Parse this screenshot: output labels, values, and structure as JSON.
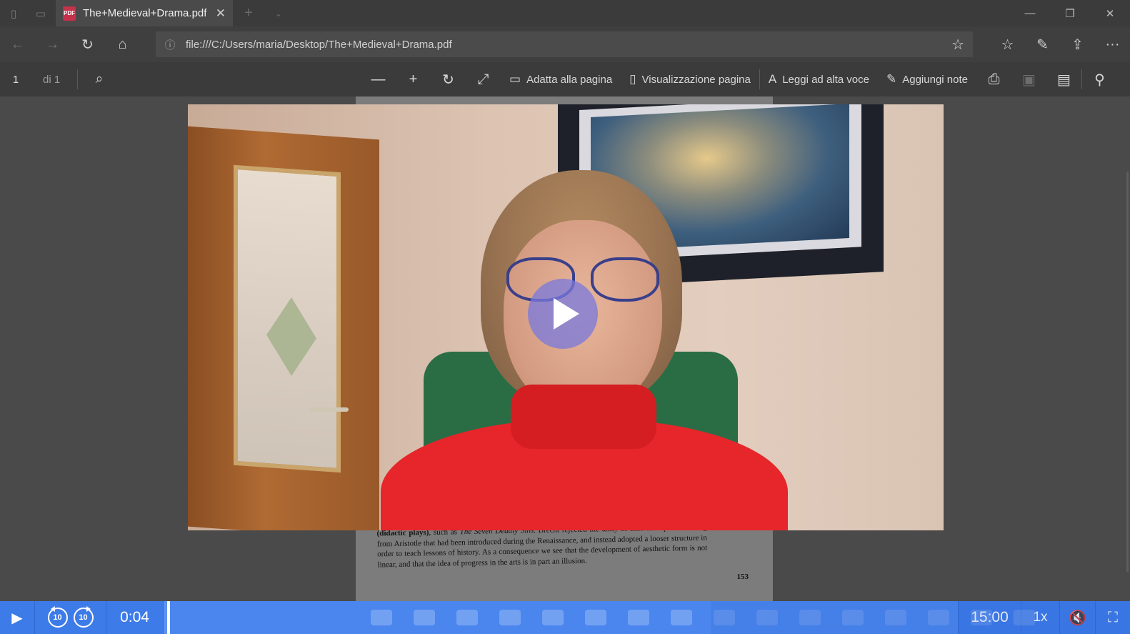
{
  "browser": {
    "tab_title": "The+Medieval+Drama.pdf",
    "tab_icon_text": "PDF",
    "url": "file:///C:/Users/maria/Desktop/The+Medieval+Drama.pdf"
  },
  "pdf_toolbar": {
    "page_current": "1",
    "page_total": "di 1",
    "fit_page_label": "Adatta alla pagina",
    "page_view_label": "Visualizzazione pagina",
    "read_aloud_label": "Leggi ad alta voce",
    "add_notes_label": "Aggiungi note"
  },
  "document": {
    "text_bold": "(didactic plays)",
    "text_pre_italic": ", such as ",
    "text_italic": "The Seven Deadly Sins",
    "text_rest": ". Brecht rejected the unity of time and space deriving from Aristotle that had been introduced during the Renaissance, and instead adopted a looser structure in order to teach lessons of history. As a consequence we see that the development of aesthetic form is not linear, and that the idea of progress in the arts is in part an illusion.",
    "page_number": "153"
  },
  "video_player": {
    "current_time": "0:04",
    "duration": "15:00",
    "speed": "1x",
    "skip_back_label": "10",
    "skip_forward_label": "10",
    "progress_fraction": 0.0044,
    "accent_color": "#3d7be8"
  },
  "icons": {
    "back": "←",
    "forward": "→",
    "refresh": "↻",
    "home": "⌂",
    "info": "ⓘ",
    "star": "☆",
    "favorites": "☆",
    "pen": "✎",
    "share": "⇪",
    "more": "···",
    "search": "⌕",
    "zoom_out": "—",
    "zoom_in": "+",
    "rotate": "↻",
    "fullscreen_pdf": "⤢",
    "fit_page": "▭",
    "page_view": "▯",
    "read_aloud": "A",
    "notes": "✎",
    "print": "⎙",
    "save": "▣",
    "save_as": "▤",
    "pin": "⚲",
    "play": "▶",
    "mute": "🔇",
    "fullscreen": "⛶",
    "minimize": "—",
    "restore": "❐",
    "close": "✕",
    "tab_close": "✕",
    "new_tab": "+",
    "tab_list": "⌄"
  }
}
